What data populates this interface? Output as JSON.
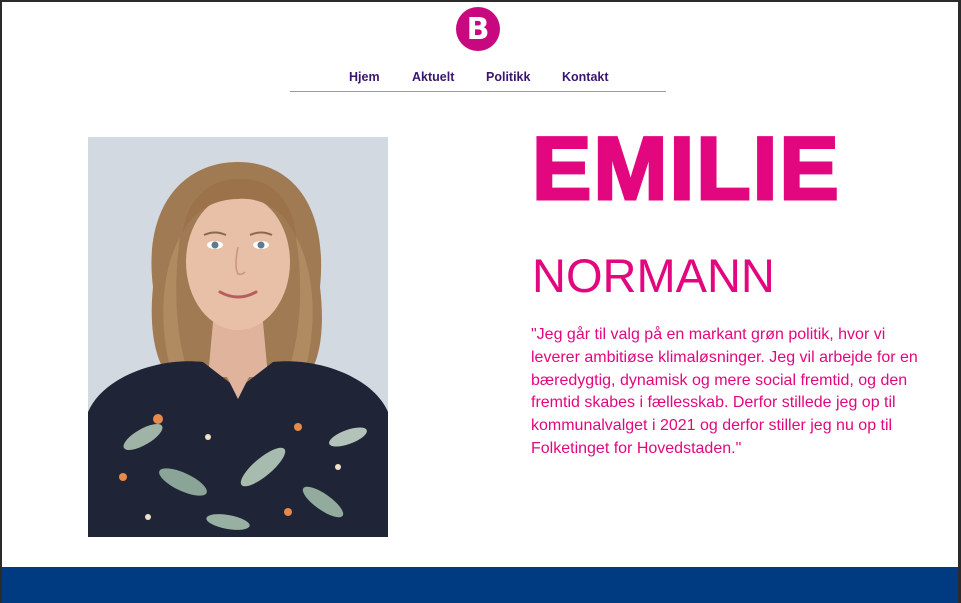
{
  "brand": {
    "logo_letter": "B",
    "logo_color": "#c8087e"
  },
  "nav": {
    "items": [
      {
        "label": "Hjem"
      },
      {
        "label": "Aktuelt"
      },
      {
        "label": "Politikk"
      },
      {
        "label": "Kontakt"
      }
    ],
    "text_color": "#3b1670"
  },
  "hero": {
    "first_name": "EMILIE",
    "last_name": "NORMANN",
    "quote": "\"Jeg går til valg på en markant grøn politik, hvor vi leverer ambitiøse klimaløsninger. Jeg vil arbejde for en bæredygtig, dynamisk og mere social fremtid, og den fremtid skabes i fællesskab. Derfor stillede jeg op til kommunalvalget i 2021 og derfor stiller jeg nu op til Folketinget for Hovedstaden.\"",
    "accent_color": "#e2077f"
  },
  "footer": {
    "color": "#003a80"
  }
}
